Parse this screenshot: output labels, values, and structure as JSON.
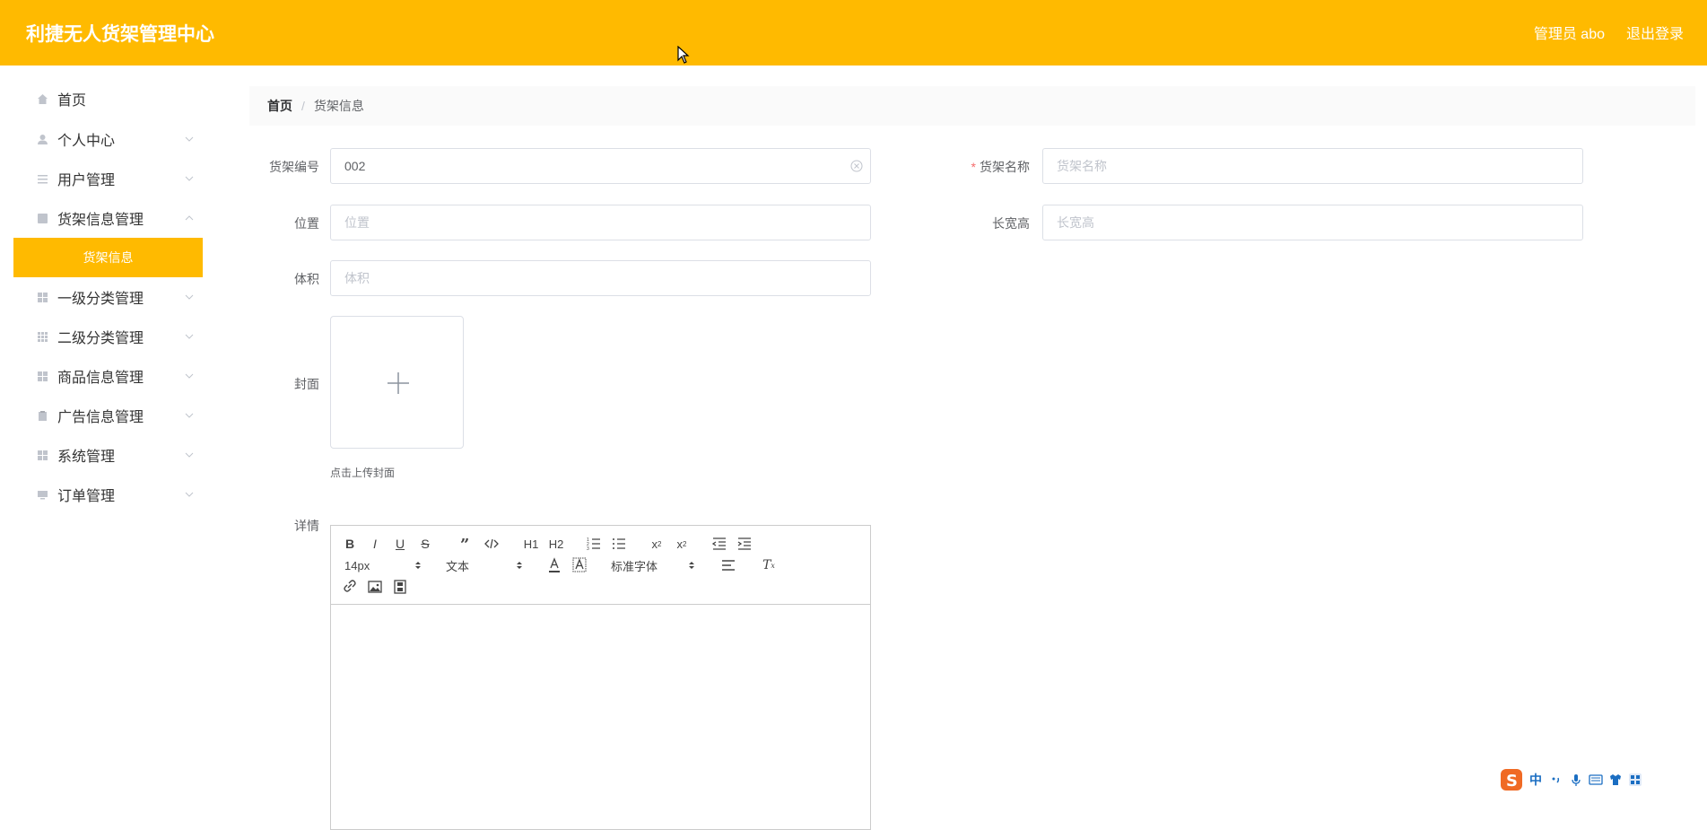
{
  "header": {
    "title": "利捷无人货架管理中心",
    "user": "管理员 abo",
    "logout": "退出登录",
    "accent_color": "#ffba00"
  },
  "sidebar": {
    "items": [
      {
        "label": "首页",
        "icon": "home-icon"
      },
      {
        "label": "个人中心",
        "icon": "user-icon"
      },
      {
        "label": "用户管理",
        "icon": "sliders-icon"
      },
      {
        "label": "货架信息管理",
        "icon": "checkbox-icon"
      },
      {
        "label": "一级分类管理",
        "icon": "grid-icon"
      },
      {
        "label": "二级分类管理",
        "icon": "grid-icon"
      },
      {
        "label": "商品信息管理",
        "icon": "grid-icon"
      },
      {
        "label": "广告信息管理",
        "icon": "clipboard-icon"
      },
      {
        "label": "系统管理",
        "icon": "grid-icon"
      },
      {
        "label": "订单管理",
        "icon": "monitor-icon"
      }
    ],
    "active_subitem": "货架信息"
  },
  "breadcrumb": {
    "home": "首页",
    "separator": "/",
    "current": "货架信息"
  },
  "form": {
    "code_label": "货架编号",
    "code_value": "002",
    "name_label": "货架名称",
    "name_placeholder": "货架名称",
    "name_required": "*",
    "location_label": "位置",
    "location_placeholder": "位置",
    "size_label": "长宽高",
    "size_placeholder": "长宽高",
    "volume_label": "体积",
    "volume_placeholder": "体积",
    "cover_label": "封面",
    "cover_tip": "点击上传封面",
    "detail_label": "详情"
  },
  "editor": {
    "font_size": "14px",
    "heading": "文本",
    "font_family": "标准字体",
    "h1": "H1",
    "h2": "H2"
  },
  "ime": {
    "mode": "中"
  }
}
